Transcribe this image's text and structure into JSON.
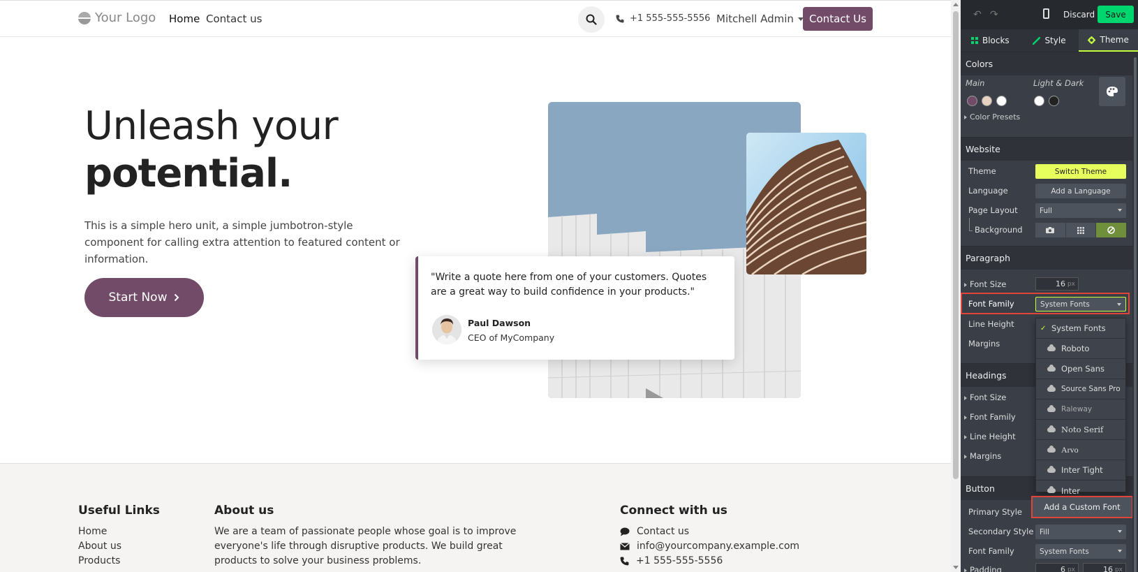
{
  "header": {
    "logo": "Your Logo",
    "nav": [
      "Home",
      "Contact us"
    ],
    "phone": "+1 555-555-5556",
    "user": "Mitchell Admin",
    "cta": "Contact Us"
  },
  "hero": {
    "title_line1": "Unleash your",
    "title_line2": "potential.",
    "text": "This is a simple hero unit, a simple jumbotron-style component for calling extra attention to featured content or information.",
    "button": "Start Now"
  },
  "quote": {
    "text": "\"Write a quote here from one of your customers. Quotes are a great way to build confidence in your products.\"",
    "name": "Paul Dawson",
    "role": "CEO of MyCompany"
  },
  "footer": {
    "useful_title": "Useful Links",
    "useful_links": [
      "Home",
      "About us",
      "Products"
    ],
    "about_title": "About us",
    "about_text": "We are a team of passionate people whose goal is to improve everyone's life through disruptive products. We build great products to solve your business problems.",
    "connect_title": "Connect with us",
    "connect": {
      "contact": "Contact us",
      "email": "info@yourcompany.example.com",
      "phone": "+1 555-555-5556"
    }
  },
  "panel": {
    "discard": "Discard",
    "save": "Save",
    "tabs": [
      "Blocks",
      "Style",
      "Theme"
    ],
    "colors": {
      "title": "Colors",
      "main_label": "Main",
      "light_dark_label": "Light & Dark",
      "presets": "Color Presets",
      "main_swatches": [
        "#714b67",
        "#e6d3c2",
        "#ffffff"
      ],
      "ld_swatches": [
        "#ffffff",
        "#222222"
      ]
    },
    "website": {
      "title": "Website",
      "theme_label": "Theme",
      "theme_button": "Switch Theme",
      "language_label": "Language",
      "language_button": "Add a Language",
      "layout_label": "Page Layout",
      "layout_value": "Full",
      "background_label": "Background"
    },
    "paragraph": {
      "title": "Paragraph",
      "font_size_label": "Font Size",
      "font_size_value": "16",
      "font_size_unit": "px",
      "font_family_label": "Font Family",
      "font_family_value": "System Fonts",
      "line_height_label": "Line Height",
      "margins_label": "Margins"
    },
    "font_options": [
      "System Fonts",
      "Roboto",
      "Open Sans",
      "Source Sans Pro",
      "Raleway",
      "Noto Serif",
      "Arvo",
      "Inter Tight",
      "Inter"
    ],
    "add_custom_font": "Add a Custom Font",
    "headings": {
      "title": "Headings",
      "font_size_label": "Font Size",
      "font_family_label": "Font Family",
      "line_height_label": "Line Height",
      "margins_label": "Margins"
    },
    "button": {
      "title": "Button",
      "primary_label": "Primary Style",
      "secondary_label": "Secondary Style",
      "secondary_value": "Fill",
      "font_family_label": "Font Family",
      "font_family_value": "System Fonts",
      "padding_label": "Padding",
      "padding_v": "6",
      "padding_h": "16",
      "padding_unit": "px"
    },
    "accent": "#c6ff3d",
    "highlight": "#e0443a"
  }
}
